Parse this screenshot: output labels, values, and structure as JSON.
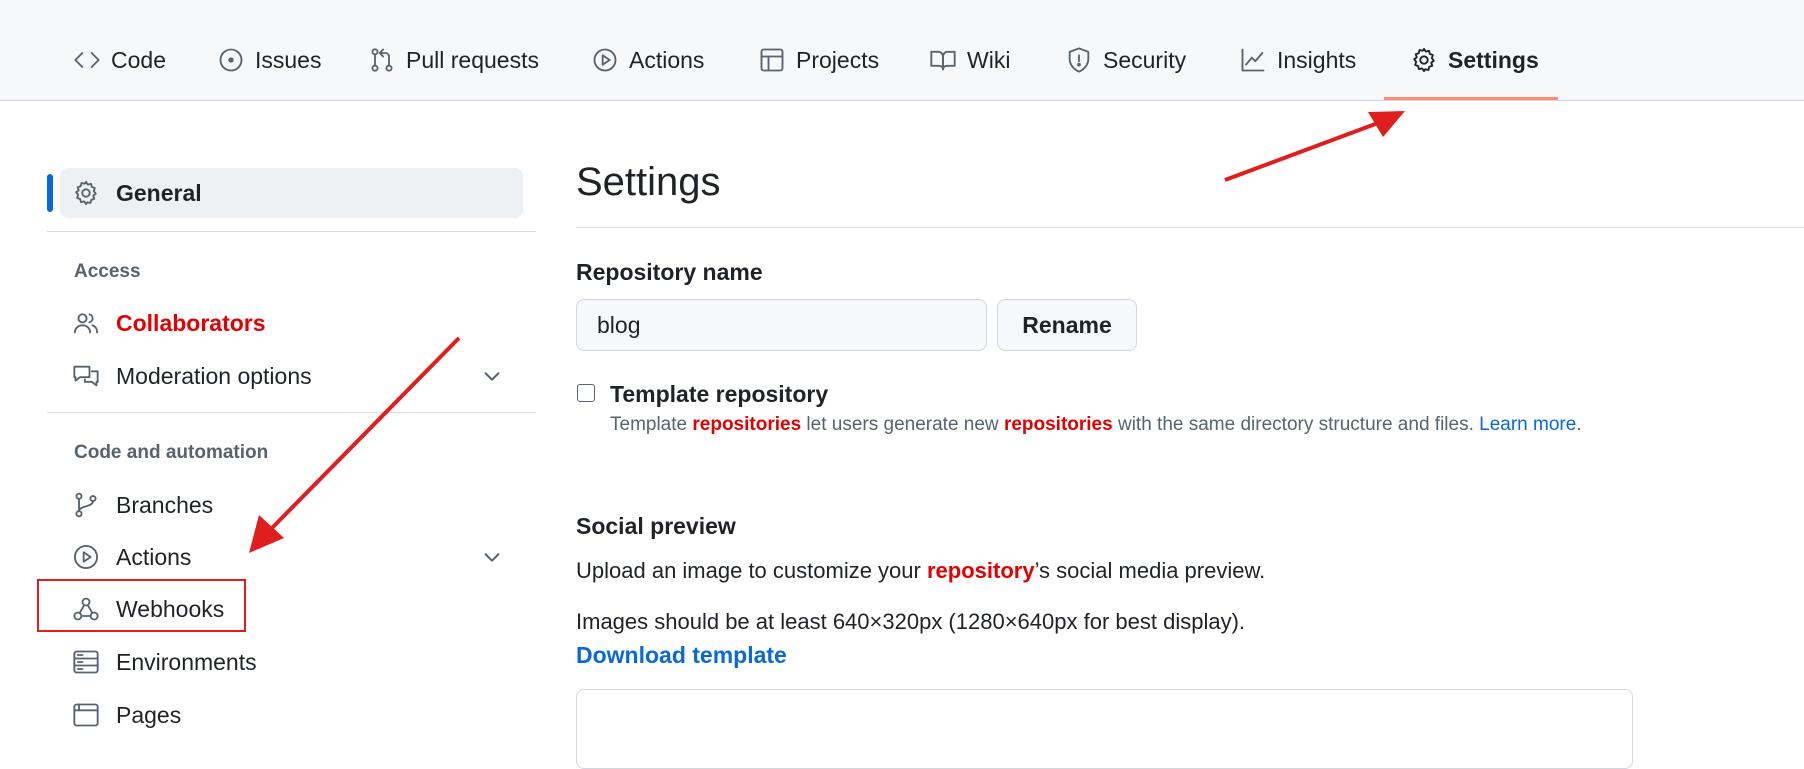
{
  "topnav": {
    "tabs": [
      {
        "label": "Code",
        "icon": "code-icon"
      },
      {
        "label": "Issues",
        "icon": "issue-icon"
      },
      {
        "label": "Pull requests",
        "icon": "pull-request-icon"
      },
      {
        "label": "Actions",
        "icon": "play-icon"
      },
      {
        "label": "Projects",
        "icon": "table-icon"
      },
      {
        "label": "Wiki",
        "icon": "book-icon"
      },
      {
        "label": "Security",
        "icon": "shield-icon"
      },
      {
        "label": "Insights",
        "icon": "graph-icon"
      },
      {
        "label": "Settings",
        "icon": "gear-icon",
        "selected": true
      }
    ]
  },
  "sidebar": {
    "general": "General",
    "access_heading": "Access",
    "collaborators": "Collaborators",
    "moderation": "Moderation options",
    "code_heading": "Code and automation",
    "branches": "Branches",
    "actions": "Actions",
    "webhooks": "Webhooks",
    "environments": "Environments",
    "pages": "Pages"
  },
  "main": {
    "title": "Settings",
    "repo_name_label": "Repository name",
    "repo_name_value": "blog",
    "rename_button": "Rename",
    "template_label": "Template repository",
    "template_note_1": "Template ",
    "template_note_2": "repositories",
    "template_note_3": " let users generate new ",
    "template_note_4": "repositories",
    "template_note_5": " with the same directory structure and files. ",
    "learn_more": "Learn more",
    "period": ".",
    "social_heading": "Social preview",
    "social_text_1": "Upload an image to customize your ",
    "social_text_2": "repository",
    "social_text_3": "’s social media preview.",
    "images_text": "Images should be at least 640×320px (1280×640px for best display).",
    "download_template": "Download template"
  },
  "colors": {
    "accent": "#0969da",
    "selected_underline": "#fd8c73",
    "highlight_red": "#e40000",
    "annotation_arrow": "#e01e1e"
  }
}
